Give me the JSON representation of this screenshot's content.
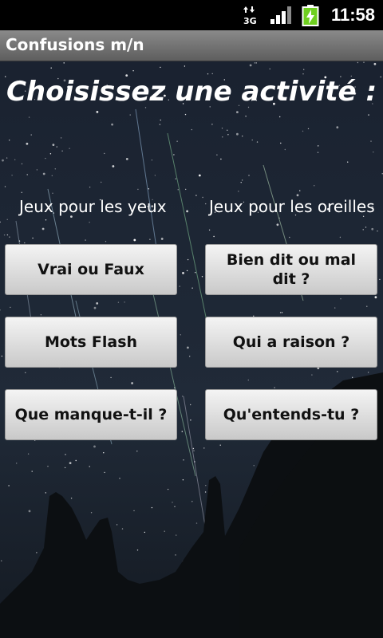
{
  "status": {
    "network": "3G",
    "time": "11:58"
  },
  "app": {
    "title": "Confusions m/n"
  },
  "main": {
    "heading": "Choisissez une activité :",
    "left_column": {
      "label": "Jeux pour les yeux",
      "buttons": [
        "Vrai ou Faux",
        "Mots Flash",
        "Que manque-t-il ?"
      ]
    },
    "right_column": {
      "label": "Jeux pour les oreilles",
      "buttons": [
        "Bien dit ou mal dit ?",
        "Qui a raison ?",
        "Qu'entends-tu ?"
      ]
    }
  }
}
